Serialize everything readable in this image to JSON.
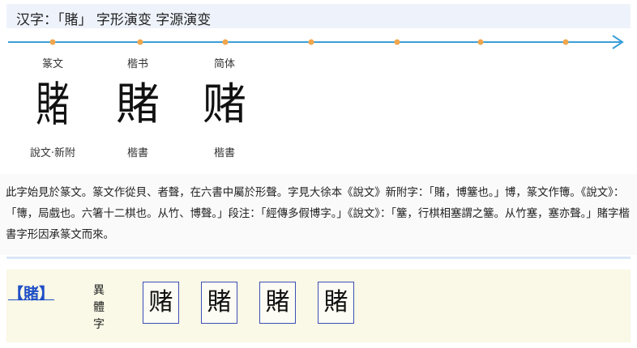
{
  "header": {
    "title": "汉字：「賭」 字形演变 字源演变"
  },
  "timeline": {
    "stops": [
      {
        "era": "篆文",
        "glyph": "賭",
        "script": "說文‧新附",
        "style": "seal"
      },
      {
        "era": "楷书",
        "glyph": "賭",
        "script": "楷書",
        "style": "kai"
      },
      {
        "era": "简体",
        "glyph": "赌",
        "script": "楷書",
        "style": "kai"
      }
    ]
  },
  "description": {
    "text": "此字始見於篆文。篆文作從貝、者聲，在六書中屬於形聲。字見大徐本《說文》新附字：「賭，博簺也。」博，篆文作簙。《說文》：「簙，局戲也。六箸十二棋也。从竹、博聲。」段注：「經傳多假博字。」《說文》：「簺，行棋相塞謂之簺。从竹塞，塞亦聲。」賭字楷書字形因承篆文而來。"
  },
  "variants": {
    "link_label": "【賭】",
    "label": "異體字",
    "items": [
      "赌",
      "賭",
      "賭",
      "賭"
    ]
  },
  "colors": {
    "timeline": "#3a9fd8",
    "dots": "#f0a64c",
    "link": "#1f4fc6",
    "panel": "#faf8e6"
  }
}
